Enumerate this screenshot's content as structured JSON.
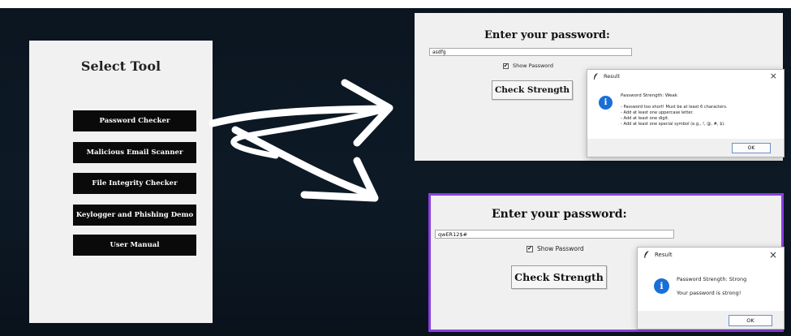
{
  "select_tool": {
    "title": "Select Tool",
    "buttons": [
      "Password Checker",
      "Malicious Email Scanner",
      "File Integrity Checker",
      "Keylogger and Phishing Demo",
      "User Manual"
    ]
  },
  "checker_top": {
    "heading": "Enter your password:",
    "password_value": "asdfg",
    "show_password_label": "Show Password",
    "show_password_checked": true,
    "check_button": "Check Strength",
    "dialog": {
      "title": "Result",
      "close": "×",
      "lines": [
        "Password Strength: Weak",
        "- Password too short! Must be at least 6 characters.",
        "- Add at least one uppercase letter.",
        "- Add at least one digit.",
        "- Add at least one special symbol (e.g., !, @, #, $)."
      ],
      "ok": "OK"
    }
  },
  "checker_bottom": {
    "heading": "Enter your password:",
    "password_value": "qwER12$#",
    "show_password_label": "Show Password",
    "show_password_checked": true,
    "check_button": "Check Strength",
    "dialog": {
      "title": "Result",
      "close": "×",
      "lines": [
        "Password Strength: Strong",
        "Your password is strong!"
      ],
      "ok": "OK"
    }
  },
  "colors": {
    "background": "#0b1520",
    "panel": "#f1f1f1",
    "button": "#0a0a0a",
    "highlight_border": "#8a3fe0",
    "info_icon": "#1a6fd6",
    "arrow": "#ffffff"
  }
}
